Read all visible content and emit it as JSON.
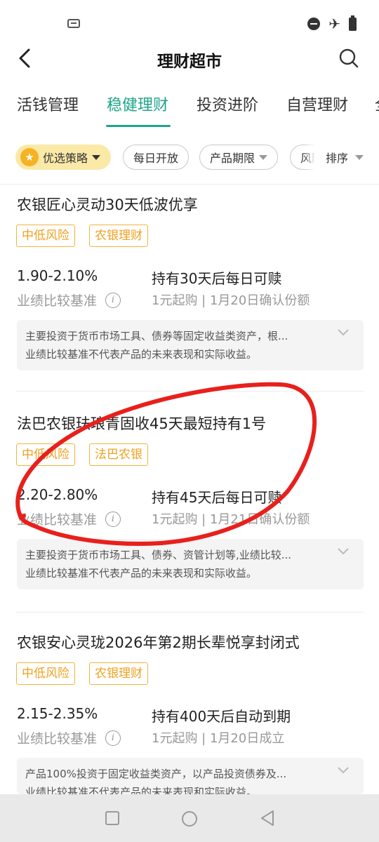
{
  "header": {
    "title": "理财超市"
  },
  "tabs": [
    {
      "label": "活钱管理"
    },
    {
      "label": "稳健理财"
    },
    {
      "label": "投资进阶"
    },
    {
      "label": "自营理财"
    },
    {
      "label": "全"
    }
  ],
  "active_tab": "稳健理财",
  "filters": {
    "strategy": "优选策略",
    "daily_open": "每日开放",
    "period": "产品期限",
    "risk": "风险",
    "sort": "排序"
  },
  "products": [
    {
      "name": "农银匠心灵动30天低波优享",
      "tags": [
        "中低风险",
        "农银理财"
      ],
      "rate": "1.90-2.10%",
      "rate_label": "业绩比较基准",
      "hold": "持有30天后每日可赎",
      "buy": "1元起购 | 1月20日确认份额",
      "desc1": "主要投资于货币市场工具、债券等固定收益类资产，根...",
      "desc2": "业绩比较基准不代表产品的未来表现和实际收益。"
    },
    {
      "name": "法巴农银珐琅青固收45天最短持有1号",
      "tags": [
        "中低风险",
        "法巴农银"
      ],
      "rate": "2.20-2.80%",
      "rate_label": "业绩比较基准",
      "hold": "持有45天后每日可赎",
      "buy": "1元起购 | 1月21日确认份额",
      "desc1": "主要投资于货币市场工具、债券、资管计划等,业绩比较...",
      "desc2": "业绩比较基准不代表产品的未来表现和实际收益。"
    },
    {
      "name": "农银安心灵珑2026年第2期长辈悦享封闭式",
      "tags": [
        "中低风险",
        "农银理财"
      ],
      "rate": "2.15-2.35%",
      "rate_label": "业绩比较基准",
      "hold": "持有400天后自动到期",
      "buy": "1元起购 | 1月20日成立",
      "desc1": "产品100%投资于固定收益类资产，以产品投资债券及...",
      "desc2": "业绩比较基准不代表产品的未来表现和实际收益。"
    }
  ],
  "colors": {
    "accent": "#1fa58a",
    "tag": "#f0a020",
    "annotation": "#e8201c"
  }
}
